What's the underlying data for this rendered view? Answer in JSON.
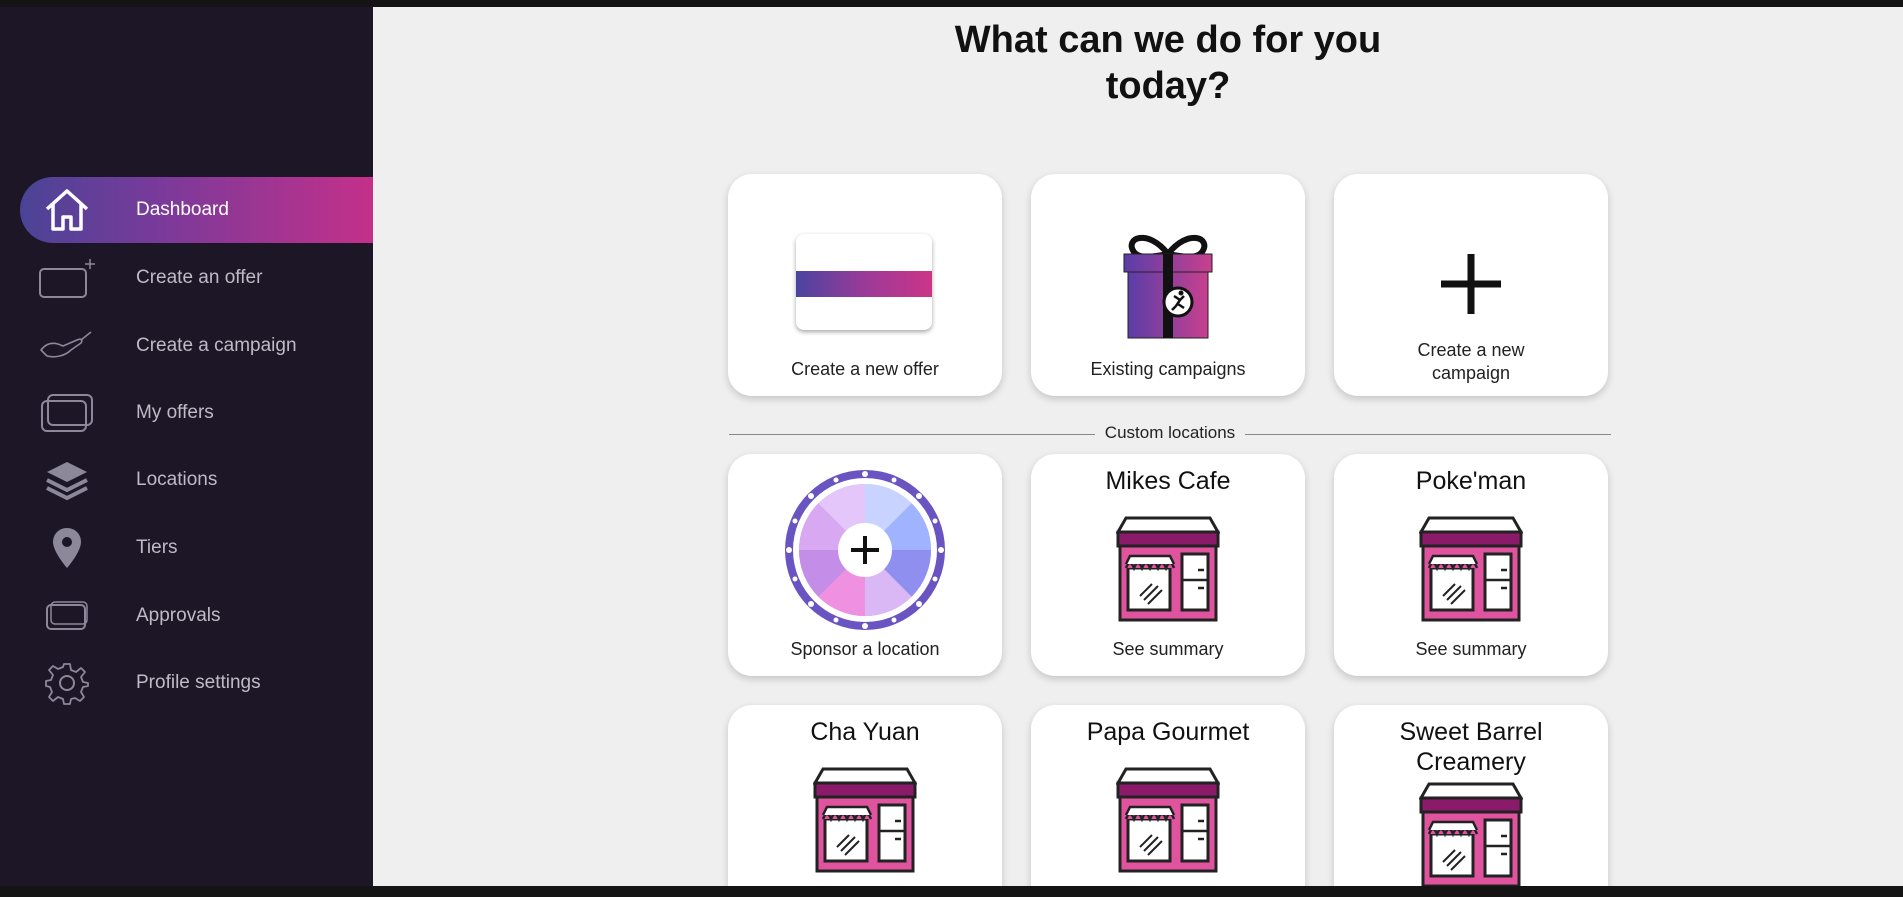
{
  "sidebar": {
    "items": [
      {
        "label": "Dashboard",
        "icon": "home-icon",
        "active": true
      },
      {
        "label": "Create an offer",
        "icon": "add-card-icon"
      },
      {
        "label": "Create a campaign",
        "icon": "handshake-icon"
      },
      {
        "label": "My offers",
        "icon": "cards-icon"
      },
      {
        "label": "Locations",
        "icon": "layers-icon"
      },
      {
        "label": "Tiers",
        "icon": "map-pin-icon"
      },
      {
        "label": "Approvals",
        "icon": "card-icon"
      },
      {
        "label": "Profile settings",
        "icon": "gear-icon"
      }
    ]
  },
  "main": {
    "heading_line1": "What can we do for you",
    "heading_line2": "today?",
    "actions": [
      {
        "label": "Create a new offer",
        "icon": "offer-card-icon"
      },
      {
        "label": "Existing campaigns",
        "icon": "gift-icon"
      },
      {
        "label": "Create a new campaign",
        "icon": "plus-icon"
      }
    ],
    "divider_label": "Custom locations",
    "sponsor": {
      "label": "Sponsor a location",
      "icon": "wheel-plus-icon"
    },
    "locations": [
      {
        "name": "Mikes Cafe",
        "link": "See summary"
      },
      {
        "name": "Poke'man",
        "link": "See summary"
      },
      {
        "name": "Cha Yuan"
      },
      {
        "name": "Papa Gourmet"
      },
      {
        "name": "Sweet Barrel Creamery"
      }
    ]
  },
  "colors": {
    "sidebar_bg": "#1d1626",
    "active_start": "#4a4496",
    "active_end": "#c4308a",
    "shop_pink": "#e0539f",
    "shop_purple": "#8c1a6b"
  }
}
